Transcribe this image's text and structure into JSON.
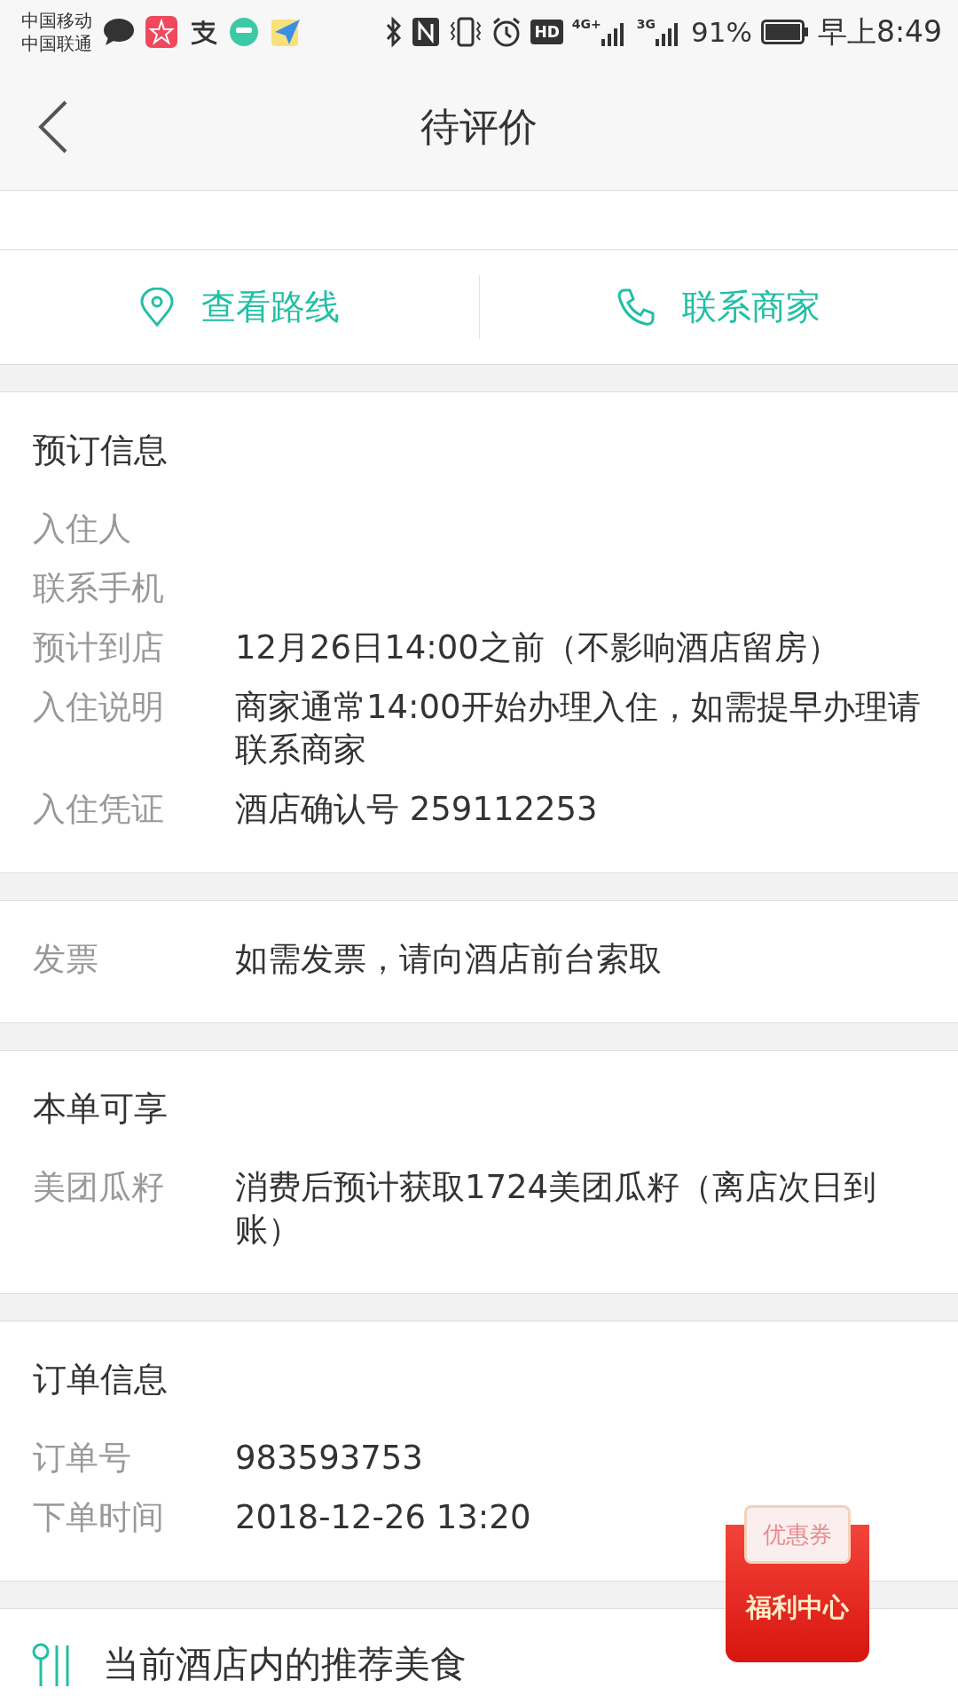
{
  "status_bar": {
    "carriers": [
      "中国移动",
      "中国联通"
    ],
    "network_1": "4G+",
    "network_2": "3G",
    "battery": "91%",
    "time": "早上8:49",
    "hd": "HD"
  },
  "header": {
    "title": "待评价"
  },
  "actions": [
    {
      "kind": "route",
      "label": "查看路线"
    },
    {
      "kind": "phone",
      "label": "联系商家"
    }
  ],
  "sections": [
    {
      "title": "预订信息",
      "rows": [
        {
          "label": "入住人"
        },
        {
          "label": "联系手机"
        },
        {
          "label": "预计到店",
          "value": "12月26日14:00之前（不影响酒店留房）"
        },
        {
          "label": "入住说明",
          "value": "商家通常14:00开始办理入住，如需提早办理请联系商家"
        },
        {
          "label": "入住凭证",
          "value": "酒店确认号 259112253"
        }
      ]
    },
    {
      "rows": [
        {
          "label": "发票",
          "value": "如需发票，请向酒店前台索取"
        }
      ]
    },
    {
      "title": "本单可享",
      "rows": [
        {
          "label": "美团瓜籽",
          "value": "消费后预计获取1724美团瓜籽（离店次日到账）"
        }
      ]
    },
    {
      "title": "订单信息",
      "rows": [
        {
          "label": "订单号",
          "value": "983593753"
        },
        {
          "label": "下单时间",
          "value": "2018-12-26 13:20"
        }
      ]
    }
  ],
  "food": {
    "title": "当前酒店内的推荐美食"
  },
  "promo": {
    "coupon": "优惠券",
    "label": "福利中心"
  }
}
